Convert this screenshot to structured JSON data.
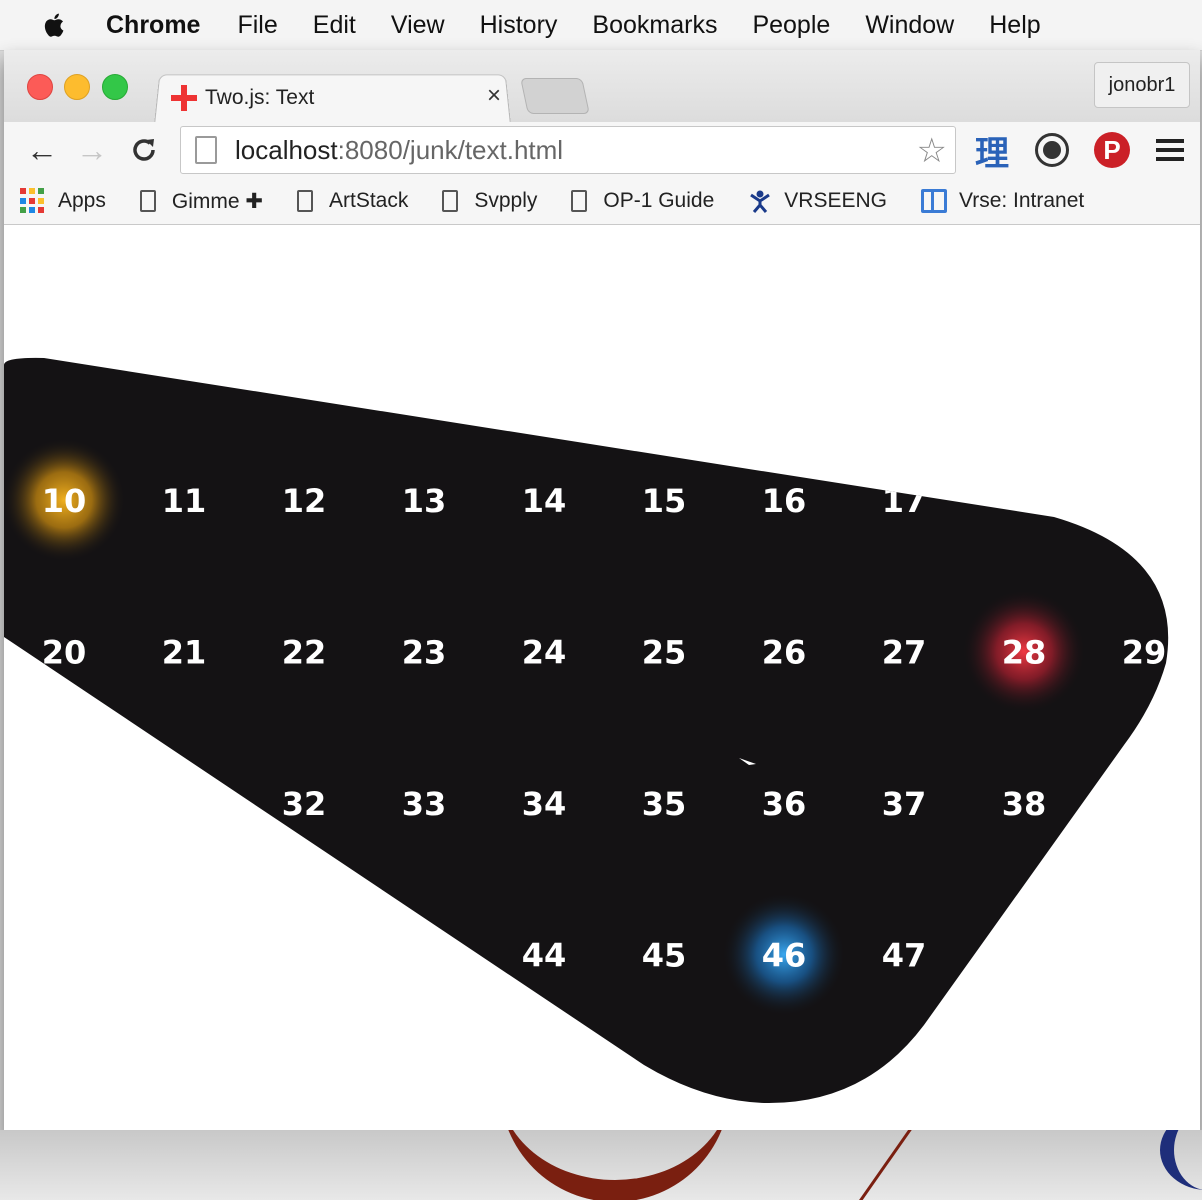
{
  "menubar": {
    "items": [
      "Chrome",
      "File",
      "Edit",
      "View",
      "History",
      "Bookmarks",
      "People",
      "Window",
      "Help"
    ]
  },
  "tab": {
    "title": "Two.js: Text",
    "close": "×",
    "favicon": "plus-icon"
  },
  "profile": {
    "name": "jonobr1"
  },
  "toolbar": {
    "back": "←",
    "forward": "→",
    "reload": "C",
    "url_host": "localhost",
    "url_rest": ":8080/junk/text.html",
    "kanji": "理",
    "pinterest": "P"
  },
  "bookmarks": {
    "apps": "Apps",
    "gimme": "Gimme ✚",
    "artstack": "ArtStack",
    "svpply": "Svpply",
    "op1": "OP-1 Guide",
    "vrseeng": "VRSEENG",
    "intranet": "Vrse: Intranet"
  },
  "canvas": {
    "numbers": [
      "10",
      "11",
      "12",
      "13",
      "14",
      "15",
      "16",
      "17",
      "20",
      "21",
      "22",
      "23",
      "24",
      "25",
      "26",
      "27",
      "28",
      "29",
      "32",
      "33",
      "34",
      "35",
      "36",
      "37",
      "38",
      "44",
      "45",
      "46",
      "47"
    ],
    "highlights": [
      {
        "label": "10",
        "color": "#e8a010"
      },
      {
        "label": "28",
        "color": "#e8323c"
      },
      {
        "label": "46",
        "color": "#2a8fe0"
      }
    ],
    "shape_color": "#141214"
  }
}
